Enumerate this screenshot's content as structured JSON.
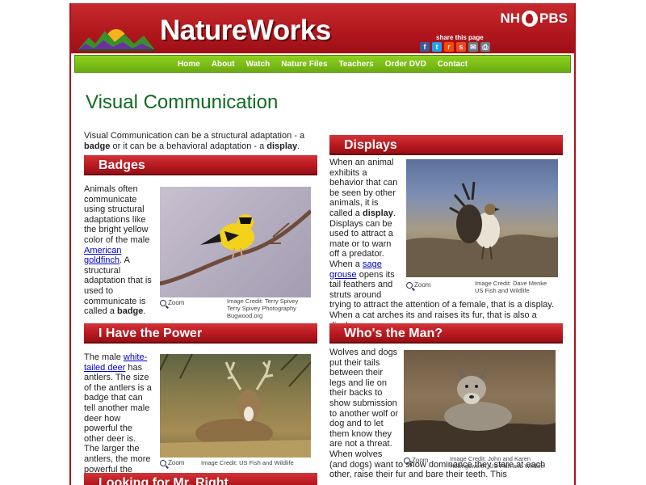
{
  "site": {
    "title": "NatureWorks",
    "network": "NH PBS",
    "network_left": "NH",
    "network_right": "PBS",
    "share_label": "share this page",
    "share_icons": [
      {
        "name": "facebook-icon",
        "glyph": "f",
        "color": "#3b5998"
      },
      {
        "name": "twitter-icon",
        "glyph": "t",
        "color": "#1da1f2"
      },
      {
        "name": "reddit-icon",
        "glyph": "r",
        "color": "#ff4500"
      },
      {
        "name": "stumbleupon-icon",
        "glyph": "s",
        "color": "#eb4924"
      },
      {
        "name": "email-icon",
        "glyph": "✉",
        "color": "#6a7b8a"
      },
      {
        "name": "print-icon",
        "glyph": "⎙",
        "color": "#6a7b8a"
      }
    ]
  },
  "nav": {
    "items": [
      "Home",
      "About",
      "Watch",
      "Nature Files",
      "Teachers",
      "Order DVD",
      "Contact"
    ]
  },
  "page": {
    "title": "Visual Communication",
    "intro_part1": "Visual Communication can be a structural adaptation - a ",
    "intro_badge": "badge",
    "intro_part2": " or it can be a behavioral adaptation - a ",
    "intro_display": "display",
    "intro_part3": "."
  },
  "sections": {
    "badges": {
      "heading": "Badges",
      "text1": "Animals often communicate using structural adaptations like the bright yellow color of the male ",
      "link": "American goldfinch",
      "text2": ". A structural adaptation that is used to communicate is called a ",
      "bold": "badge",
      "text3": ".",
      "zoom": "Zoom",
      "credit_line1": "Image Credit: Terry Spivey",
      "credit_line2": "Terry Spivey Photography",
      "credit_line3": "Bugwood.org"
    },
    "power": {
      "heading": "I Have the Power",
      "text1": "The male ",
      "link": "white-tailed deer",
      "text2": " has antlers. The size of the antlers is a badge that can tell another male deer how powerful the other deer is. The larger the antlers, the more powerful the deer!",
      "zoom": "Zoom",
      "credit_line1": "Image Credit: US Fish and Wildlife"
    },
    "mr_right": {
      "heading": "Looking for Mr. Right"
    },
    "displays": {
      "heading": "Displays",
      "text1": "When an animal exhibits a behavior that can be seen by other animals, it is called a ",
      "bold": "display",
      "text2": ". Displays can be used to attract a mate or to warn off a predator. When a ",
      "link": "sage grouse",
      "text3": " opens its tail feathers and struts around trying to attract the attention of a female, that is a display. When a cat arches its and raises its fur, that is also a display.",
      "zoom": "Zoom",
      "credit_line1": "Image Credit: Dave Menke",
      "credit_line2": "US Fish and Wildlife"
    },
    "whos_man": {
      "heading": "Who's the Man?",
      "text1": "Wolves and dogs put their tails between their legs and lie on their backs to show submission to another wolf or dog and to let them know they are not a threat. When wolves (and dogs) want to show dominance they stare at each other, raise their fur and bare their teeth. This",
      "zoom": "Zoom",
      "credit_line1": "Image Credit: John and Karen",
      "credit_line2": "Hollingsworth, US Fish and Wildlife"
    }
  }
}
